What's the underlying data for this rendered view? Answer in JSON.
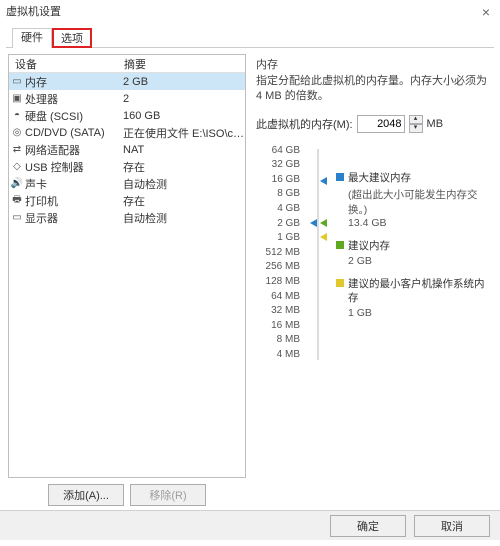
{
  "window": {
    "title": "虚拟机设置",
    "close_label": "×"
  },
  "tabs": {
    "hardware": "硬件",
    "options": "选项"
  },
  "left": {
    "header_device": "设备",
    "header_summary": "摘要",
    "rows": [
      {
        "icon": "▭",
        "device": "内存",
        "summary": "2 GB",
        "selected": true
      },
      {
        "icon": "▣",
        "device": "处理器",
        "summary": "2"
      },
      {
        "icon": "◓",
        "device": "硬盘 (SCSI)",
        "summary": "160 GB"
      },
      {
        "icon": "◎",
        "device": "CD/DVD (SATA)",
        "summary": "正在使用文件 E:\\ISO\\cn_win..."
      },
      {
        "icon": "⇄",
        "device": "网络适配器",
        "summary": "NAT"
      },
      {
        "icon": "◇",
        "device": "USB 控制器",
        "summary": "存在"
      },
      {
        "icon": "🔊",
        "device": "声卡",
        "summary": "自动检测"
      },
      {
        "icon": "🖶",
        "device": "打印机",
        "summary": "存在"
      },
      {
        "icon": "▭",
        "device": "显示器",
        "summary": "自动检测"
      }
    ],
    "add_label": "添加(A)...",
    "remove_label": "移除(R)"
  },
  "right": {
    "section_title": "内存",
    "desc": "指定分配给此虚拟机的内存量。内存大小必须为 4 MB 的倍数。",
    "mem_label": "此虚拟机的内存(M):",
    "mem_value": "2048",
    "mem_unit": "MB",
    "ticks": [
      "64 GB",
      "32 GB",
      "16 GB",
      "8 GB",
      "4 GB",
      "2 GB",
      "1 GB",
      "512 MB",
      "256 MB",
      "128 MB",
      "64 MB",
      "32 MB",
      "16 MB",
      "8 MB",
      "4 MB"
    ],
    "legend": {
      "max_title": "最大建议内存",
      "max_note": "(超出此大小可能发生内存交换。)",
      "max_value": "13.4 GB",
      "rec_title": "建议内存",
      "rec_value": "2 GB",
      "min_title": "建议的最小客户机操作系统内存",
      "min_value": "1 GB"
    }
  },
  "bottom": {
    "ok": "确定",
    "cancel": "取消"
  }
}
